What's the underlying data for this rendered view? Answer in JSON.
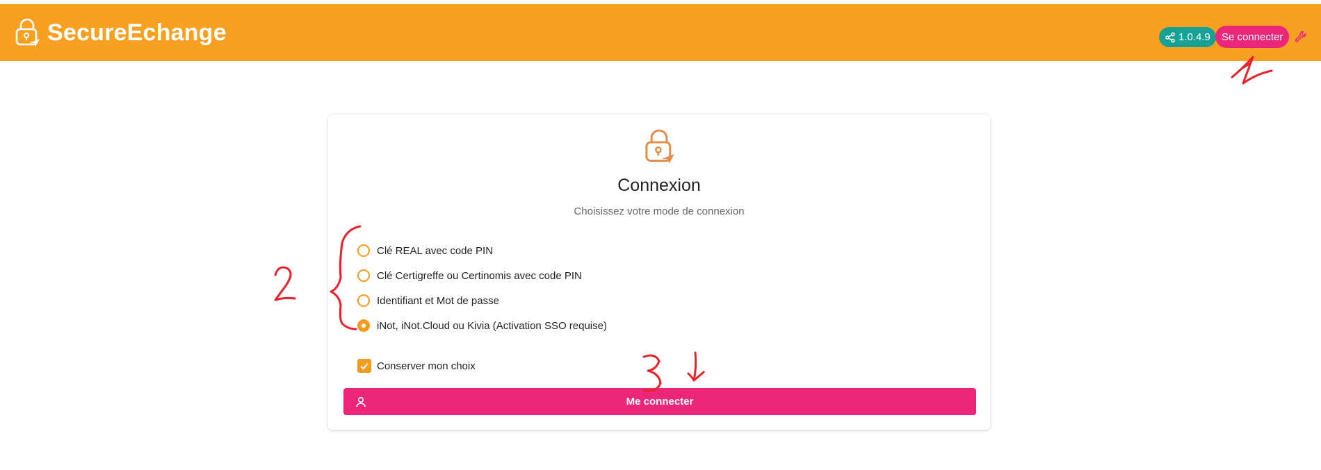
{
  "header": {
    "app_name": "SecureEchange",
    "version": "1.0.4.9",
    "login_button": "Se connecter",
    "colors": {
      "bar": "#f7a021",
      "version_badge": "#17a195",
      "login_button": "#ec2678"
    },
    "icons": {
      "logo": "lock-paperplane-icon",
      "version": "share-icon",
      "settings": "wrench-icon"
    }
  },
  "login": {
    "title": "Connexion",
    "subtitle": "Choisissez votre mode de connexion",
    "options": [
      {
        "label": "Clé REAL avec code PIN",
        "selected": false
      },
      {
        "label": "Clé Certigreffe ou Certinomis avec code PIN",
        "selected": false
      },
      {
        "label": "Identifiant et Mot de passe",
        "selected": false
      },
      {
        "label": "iNot, iNot.Cloud ou Kivia (Activation SSO requise)",
        "selected": true
      }
    ],
    "remember_label": "Conserver mon choix",
    "remember_checked": true,
    "submit_label": "Me connecter",
    "icons": {
      "logo": "lock-paperplane-icon",
      "submit": "user-icon"
    },
    "colors": {
      "accent": "#f39b20",
      "submit": "#ec2678"
    }
  },
  "annotations": {
    "marks": [
      "1",
      "2",
      "3"
    ],
    "color": "#e8212b"
  }
}
